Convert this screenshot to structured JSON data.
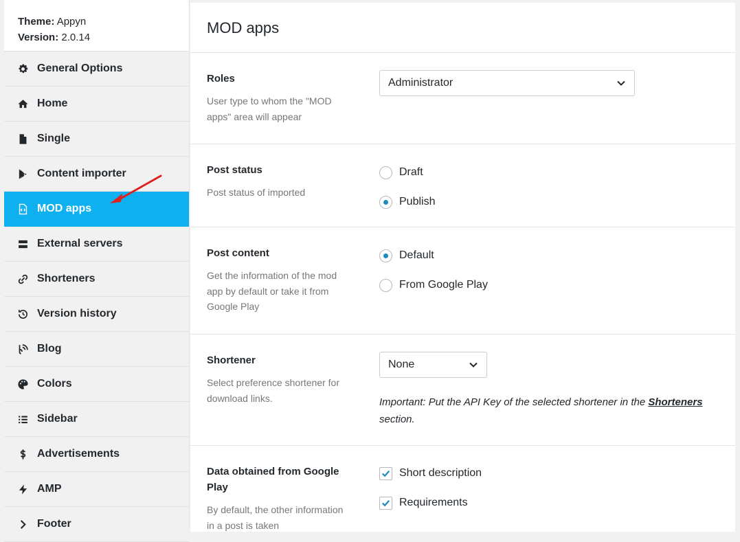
{
  "theme": {
    "theme_label": "Theme:",
    "theme_value": "Appyn",
    "version_label": "Version:",
    "version_value": "2.0.14"
  },
  "sidebar": {
    "items": [
      {
        "label": "General Options",
        "icon": "gear-icon"
      },
      {
        "label": "Home",
        "icon": "home-icon"
      },
      {
        "label": "Single",
        "icon": "file-icon"
      },
      {
        "label": "Content importer",
        "icon": "play-store-icon"
      },
      {
        "label": "MOD apps",
        "icon": "code-file-icon",
        "active": true
      },
      {
        "label": "External servers",
        "icon": "server-icon"
      },
      {
        "label": "Shorteners",
        "icon": "link-icon"
      },
      {
        "label": "Version history",
        "icon": "history-icon"
      },
      {
        "label": "Blog",
        "icon": "blog-icon"
      },
      {
        "label": "Colors",
        "icon": "palette-icon"
      },
      {
        "label": "Sidebar",
        "icon": "list-icon"
      },
      {
        "label": "Advertisements",
        "icon": "dollar-icon"
      },
      {
        "label": "AMP",
        "icon": "bolt-icon"
      },
      {
        "label": "Footer",
        "icon": "chevron-right-icon"
      }
    ]
  },
  "main": {
    "title": "MOD apps",
    "roles": {
      "title": "Roles",
      "desc": "User type to whom the \"MOD apps\" area will appear",
      "selected": "Administrator"
    },
    "post_status": {
      "title": "Post status",
      "desc": "Post status of imported",
      "options": [
        {
          "label": "Draft",
          "checked": false
        },
        {
          "label": "Publish",
          "checked": true
        }
      ]
    },
    "post_content": {
      "title": "Post content",
      "desc": "Get the information of the mod app by default or take it from Google Play",
      "options": [
        {
          "label": "Default",
          "checked": true
        },
        {
          "label": "From Google Play",
          "checked": false
        }
      ]
    },
    "shortener": {
      "title": "Shortener",
      "desc": "Select preference shortener for download links.",
      "selected": "None",
      "note_prefix": "Important: Put the API Key of the selected shortener in the",
      "note_link": "Shorteners",
      "note_suffix": "section."
    },
    "data_gp": {
      "title": "Data obtained from Google Play",
      "desc": "By default, the other information in a post is taken",
      "options": [
        {
          "label": "Short description",
          "checked": true
        },
        {
          "label": "Requirements",
          "checked": true
        }
      ]
    }
  },
  "colors": {
    "active_bg": "#0fb0ef",
    "radio_dot": "#1e8cbe",
    "arrow": "#e02020"
  }
}
